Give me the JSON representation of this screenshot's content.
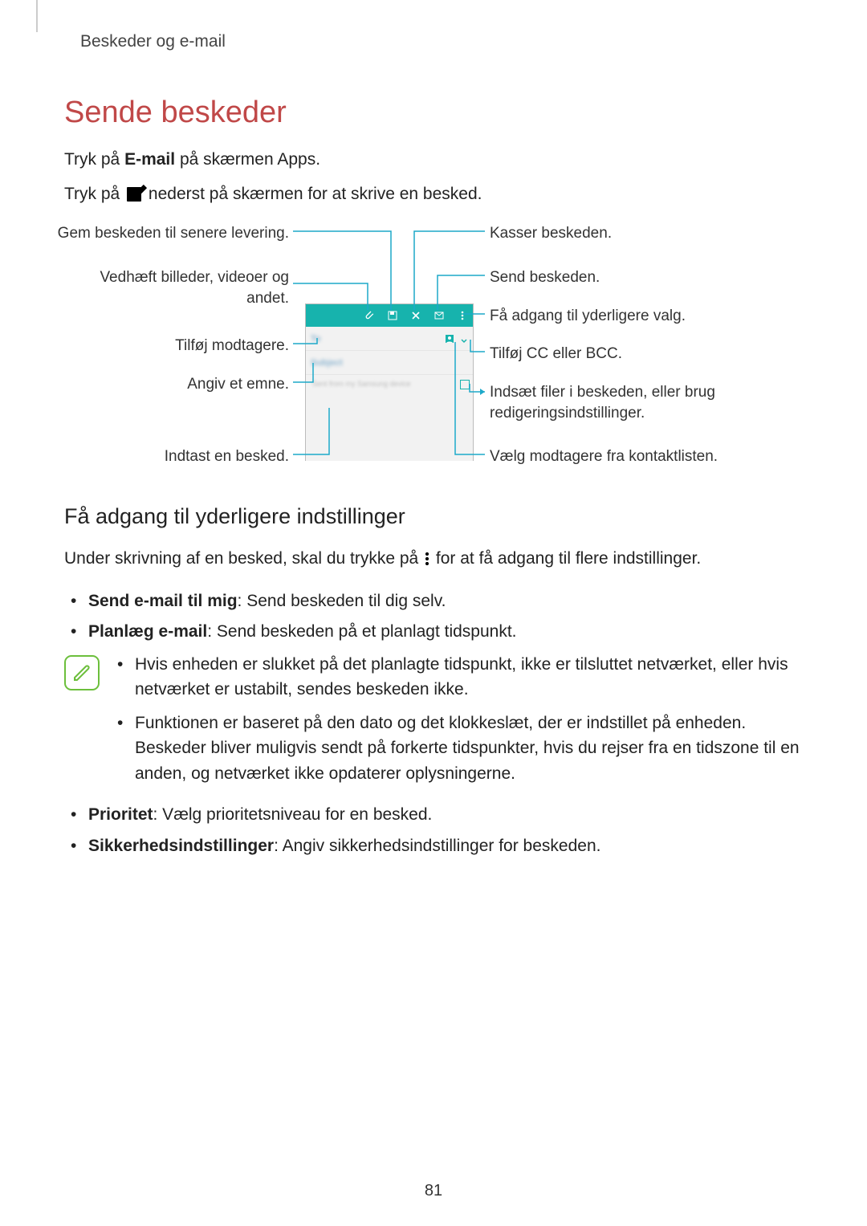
{
  "page": {
    "breadcrumb": "Beskeder og e-mail",
    "title": "Sende beskeder",
    "intro1_pre": "Tryk på ",
    "intro1_bold": "E-mail",
    "intro1_post": " på skærmen Apps.",
    "intro2_pre": "Tryk på ",
    "intro2_post": " nederst på skærmen for at skrive en besked.",
    "page_number": "81"
  },
  "diagram": {
    "left": {
      "save": "Gem beskeden til senere levering.",
      "attach": "Vedhæft billeder, videoer og andet.",
      "recipients": "Tilføj modtagere.",
      "subject": "Angiv et emne.",
      "body": "Indtast en besked."
    },
    "right": {
      "discard": "Kasser beskeden.",
      "send": "Send beskeden.",
      "more": "Få adgang til yderligere valg.",
      "ccbcc": "Tilføj CC eller BCC.",
      "insert": "Indsæt filer i beskeden, eller brug redigeringsindstillinger.",
      "contacts": "Vælg modtagere fra kontaktlisten."
    },
    "phone": {
      "to": "To",
      "subject": "Subject",
      "body_hint": "Sent from my Samsung device"
    }
  },
  "section2": {
    "heading": "Få adgang til yderligere indstillinger",
    "lead_pre": "Under skrivning af en besked, skal du trykke på ",
    "lead_post": " for at få adgang til flere indstillinger.",
    "items": {
      "send_self_bold": "Send e-mail til mig",
      "send_self_rest": ": Send beskeden til dig selv.",
      "schedule_bold": "Planlæg e-mail",
      "schedule_rest": ": Send beskeden på et planlagt tidspunkt.",
      "note1": "Hvis enheden er slukket på det planlagte tidspunkt, ikke er tilsluttet netværket, eller hvis netværket er ustabilt, sendes beskeden ikke.",
      "note2": "Funktionen er baseret på den dato og det klokkeslæt, der er indstillet på enheden. Beskeder bliver muligvis sendt på forkerte tidspunkter, hvis du rejser fra en tidszone til en anden, og netværket ikke opdaterer oplysningerne.",
      "priority_bold": "Prioritet",
      "priority_rest": ": Vælg prioritetsniveau for en besked.",
      "security_bold": "Sikkerhedsindstillinger",
      "security_rest": ": Angiv sikkerhedsindstillinger for beskeden."
    }
  }
}
